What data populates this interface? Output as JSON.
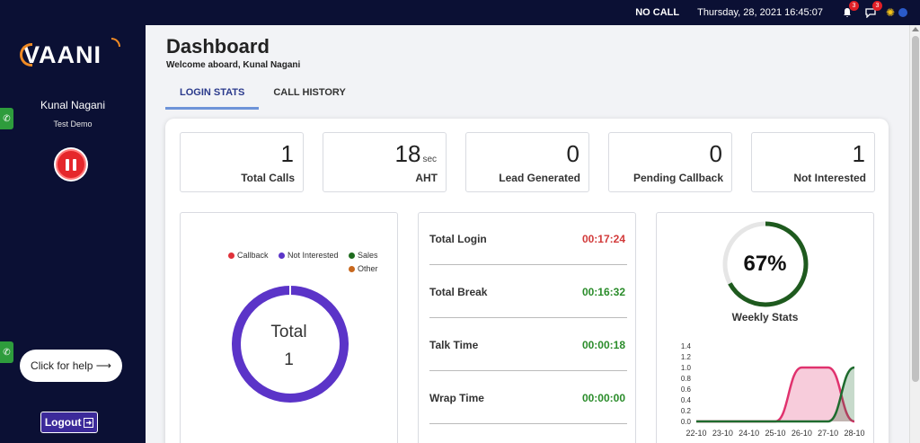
{
  "topbar": {
    "call_status": "NO CALL",
    "datetime": "Thursday, 28, 2021 16:45:07",
    "notifications_count": "3",
    "messages_count": "3"
  },
  "sidebar": {
    "logo": "VAANI",
    "agent_name": "Kunal Nagani",
    "agent_team": "Test Demo",
    "help_label": "Click for help ⟶",
    "logout_label": "Logout"
  },
  "header": {
    "title": "Dashboard",
    "welcome": "Welcome aboard, Kunal Nagani"
  },
  "tabs": [
    {
      "label": "LOGIN STATS",
      "active": true
    },
    {
      "label": "CALL HISTORY",
      "active": false
    }
  ],
  "stats": [
    {
      "value": "1",
      "unit": "",
      "label": "Total Calls"
    },
    {
      "value": "18",
      "unit": "sec",
      "label": "AHT"
    },
    {
      "value": "0",
      "unit": "",
      "label": "Lead Generated"
    },
    {
      "value": "0",
      "unit": "",
      "label": "Pending Callback"
    },
    {
      "value": "1",
      "unit": "",
      "label": "Not Interested"
    }
  ],
  "donut": {
    "legend": [
      {
        "label": "Callback",
        "color": "#e0323a"
      },
      {
        "label": "Not Interested",
        "color": "#5b34c8"
      },
      {
        "label": "Sales",
        "color": "#1e6b1e"
      },
      {
        "label": "Other",
        "color": "#c8681e"
      }
    ],
    "center_title": "Total",
    "center_value": "1",
    "ring_color": "#5b34c8"
  },
  "times": [
    {
      "label": "Total Login",
      "value": "00:17:24",
      "color": "#d23a3a"
    },
    {
      "label": "Total Break",
      "value": "00:16:32",
      "color": "#2a8c2a"
    },
    {
      "label": "Talk Time",
      "value": "00:00:18",
      "color": "#2a8c2a"
    },
    {
      "label": "Wrap Time",
      "value": "00:00:00",
      "color": "#2a8c2a"
    }
  ],
  "weekly": {
    "percent": "67%",
    "progress": 0.67,
    "label": "Weekly Stats",
    "ring_color": "#1e5a1e"
  },
  "chart_data": {
    "type": "area",
    "categories": [
      "22-10",
      "23-10",
      "24-10",
      "25-10",
      "26-10",
      "27-10",
      "28-10"
    ],
    "series": [
      {
        "values": [
          0,
          0,
          0,
          0,
          1.0,
          1.0,
          0
        ],
        "color": "#e0326e"
      },
      {
        "values": [
          0,
          0,
          0,
          0,
          0,
          0,
          1.0
        ],
        "color": "#1e6b2e"
      }
    ],
    "y_ticks": [
      "0.0",
      "0.2",
      "0.4",
      "0.6",
      "0.8",
      "1.0",
      "1.2",
      "1.4"
    ],
    "ylim": [
      0,
      1.4
    ]
  }
}
